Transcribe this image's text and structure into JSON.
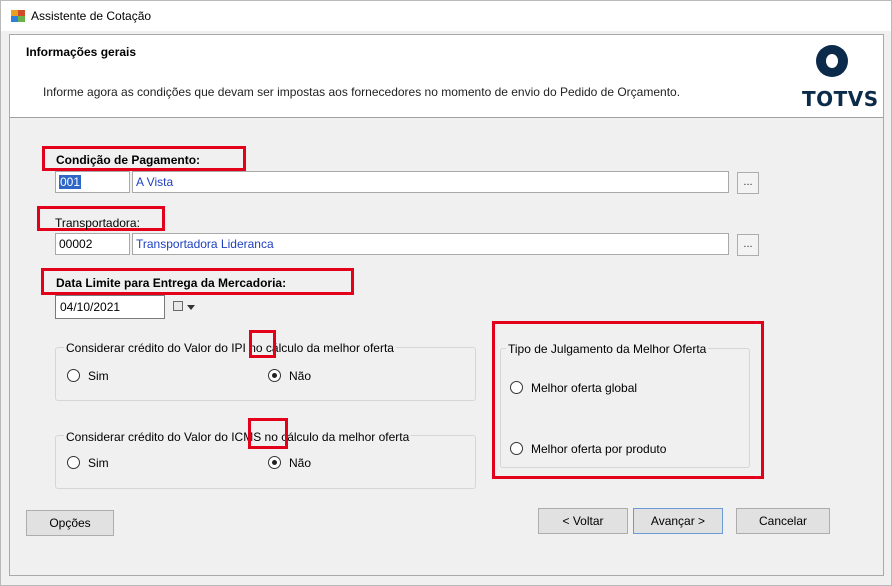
{
  "window": {
    "title": "Assistente de Cotação"
  },
  "header": {
    "title": "Informações gerais",
    "subtitle": "Informe agora as condições que devam ser impostas aos fornecedores no momento de envio do Pedido de Orçamento.",
    "logo": "TOTVS"
  },
  "payment": {
    "label": "Condição de Pagamento:",
    "code": "001",
    "description": "A Vista",
    "lookup": "..."
  },
  "carrier": {
    "label": "Transportadora:",
    "code": "00002",
    "description": "Transportadora Lideranca",
    "lookup": "..."
  },
  "delivery": {
    "label": "Data Limite para Entrega da Mercadoria:",
    "date": "04/10/2021"
  },
  "ipi_group": {
    "title_pre": "Considerar crédito do Valor do ",
    "title_tax": "IPI",
    "title_post": " no cálculo da melhor oferta",
    "options": [
      {
        "label": "Sim",
        "selected": false
      },
      {
        "label": "Não",
        "selected": true
      }
    ]
  },
  "icms_group": {
    "title_pre": "Considerar crédito do Valor do ",
    "title_tax": "ICMS",
    "title_post": " no cálculo da melhor oferta",
    "options": [
      {
        "label": "Sim",
        "selected": false
      },
      {
        "label": "Não",
        "selected": true
      }
    ]
  },
  "judgment_group": {
    "title": "Tipo de Julgamento da Melhor Oferta",
    "options": [
      {
        "label": "Melhor oferta global",
        "selected": false
      },
      {
        "label": "Melhor oferta por produto",
        "selected": false
      }
    ]
  },
  "footer": {
    "options": "Opções",
    "back": "< Voltar",
    "next": "Avançar >",
    "cancel": "Cancelar"
  },
  "colors": {
    "highlight_border": "#e3001b",
    "logo": "#0c2b4b",
    "selection": "#2d67c7",
    "link_text": "#1d3fbf"
  }
}
